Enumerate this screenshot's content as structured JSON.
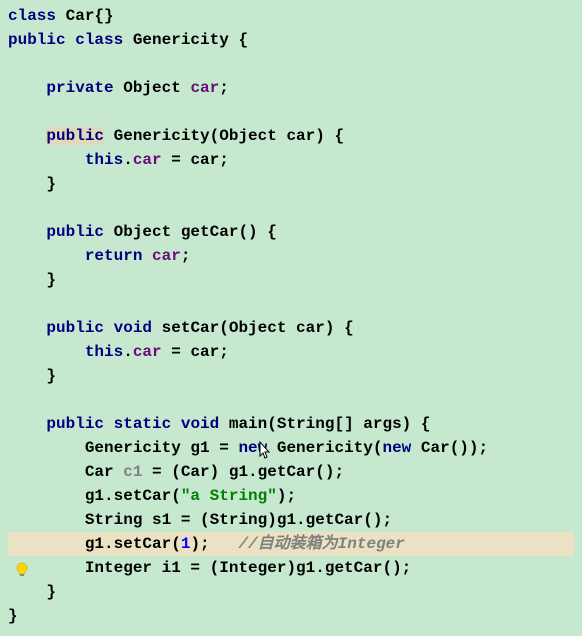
{
  "code": {
    "l1_class": "class",
    "l1_car": " Car{}",
    "l2_public": "public",
    "l2_class": " class",
    "l2_name": " Genericity {",
    "l3": "",
    "l4_private": "private",
    "l4_obj": " Object ",
    "l4_car": "car",
    "l4_semi": ";",
    "l5": "",
    "l6_public": "public",
    "l6_name": " Genericity(Object car) {",
    "l7_this": "this",
    "l7_dot": ".",
    "l7_car": "car",
    "l7_eq": " = car;",
    "l8": "    }",
    "l9": "",
    "l10_public": "public",
    "l10_rest": " Object getCar() {",
    "l11_return": "return",
    "l11_sp": " ",
    "l11_car": "car",
    "l11_semi": ";",
    "l12": "    }",
    "l13": "",
    "l14_public": "public",
    "l14_void": " void",
    "l14_rest": " setCar(Object car) {",
    "l15_this": "this",
    "l15_dot": ".",
    "l15_car": "car",
    "l15_eq": " = car;",
    "l16": "    }",
    "l17": "",
    "l18_public": "public",
    "l18_static": " static",
    "l18_void": " void",
    "l18_main": " main(String[] args) {",
    "l19_gen": "        Genericity g1 = ",
    "l19_new1": "new",
    "l19_gen2": " Genericity(",
    "l19_new2": "new",
    "l19_car": " Car());",
    "l20_car": "        Car ",
    "l20_c1": "c1",
    "l20_rest": " = (Car) g1.getCar();",
    "l21_set": "        g1.setCar(",
    "l21_str": "\"a String\"",
    "l21_end": ");",
    "l22": "        String s1 = (String)g1.getCar();",
    "l23_set": "        g1.setCar(",
    "l23_num": "1",
    "l23_end": ");   ",
    "l23_comment": "//自动装箱为Integer",
    "l24": "        Integer i1 = (Integer)g1.getCar();",
    "l25": "    }",
    "l26": "}"
  },
  "icons": {
    "lightbulb": "lightbulb-icon",
    "cursor": "cursor-icon"
  }
}
